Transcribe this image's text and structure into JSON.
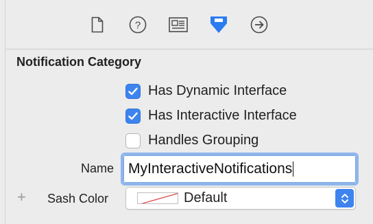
{
  "toolbar": {
    "icons": [
      "file-inspector-icon",
      "quick-help-icon",
      "identity-inspector-icon",
      "attributes-inspector-icon",
      "connections-inspector-icon"
    ],
    "active_color": "#2a7cf0",
    "inactive_color": "#4a4a4a"
  },
  "section": {
    "title": "Notification Category"
  },
  "options": [
    {
      "label": "Has Dynamic Interface",
      "checked": true
    },
    {
      "label": "Has Interactive Interface",
      "checked": true
    },
    {
      "label": "Handles Grouping",
      "checked": false
    }
  ],
  "name_field": {
    "label": "Name",
    "value": "MyInteractiveNotifications"
  },
  "sash_color": {
    "add_symbol": "+",
    "label": "Sash Color",
    "value": "Default"
  },
  "colors": {
    "accent": "#3d84ef",
    "focus_ring": "#8fb6ec",
    "background": "#ececec"
  }
}
